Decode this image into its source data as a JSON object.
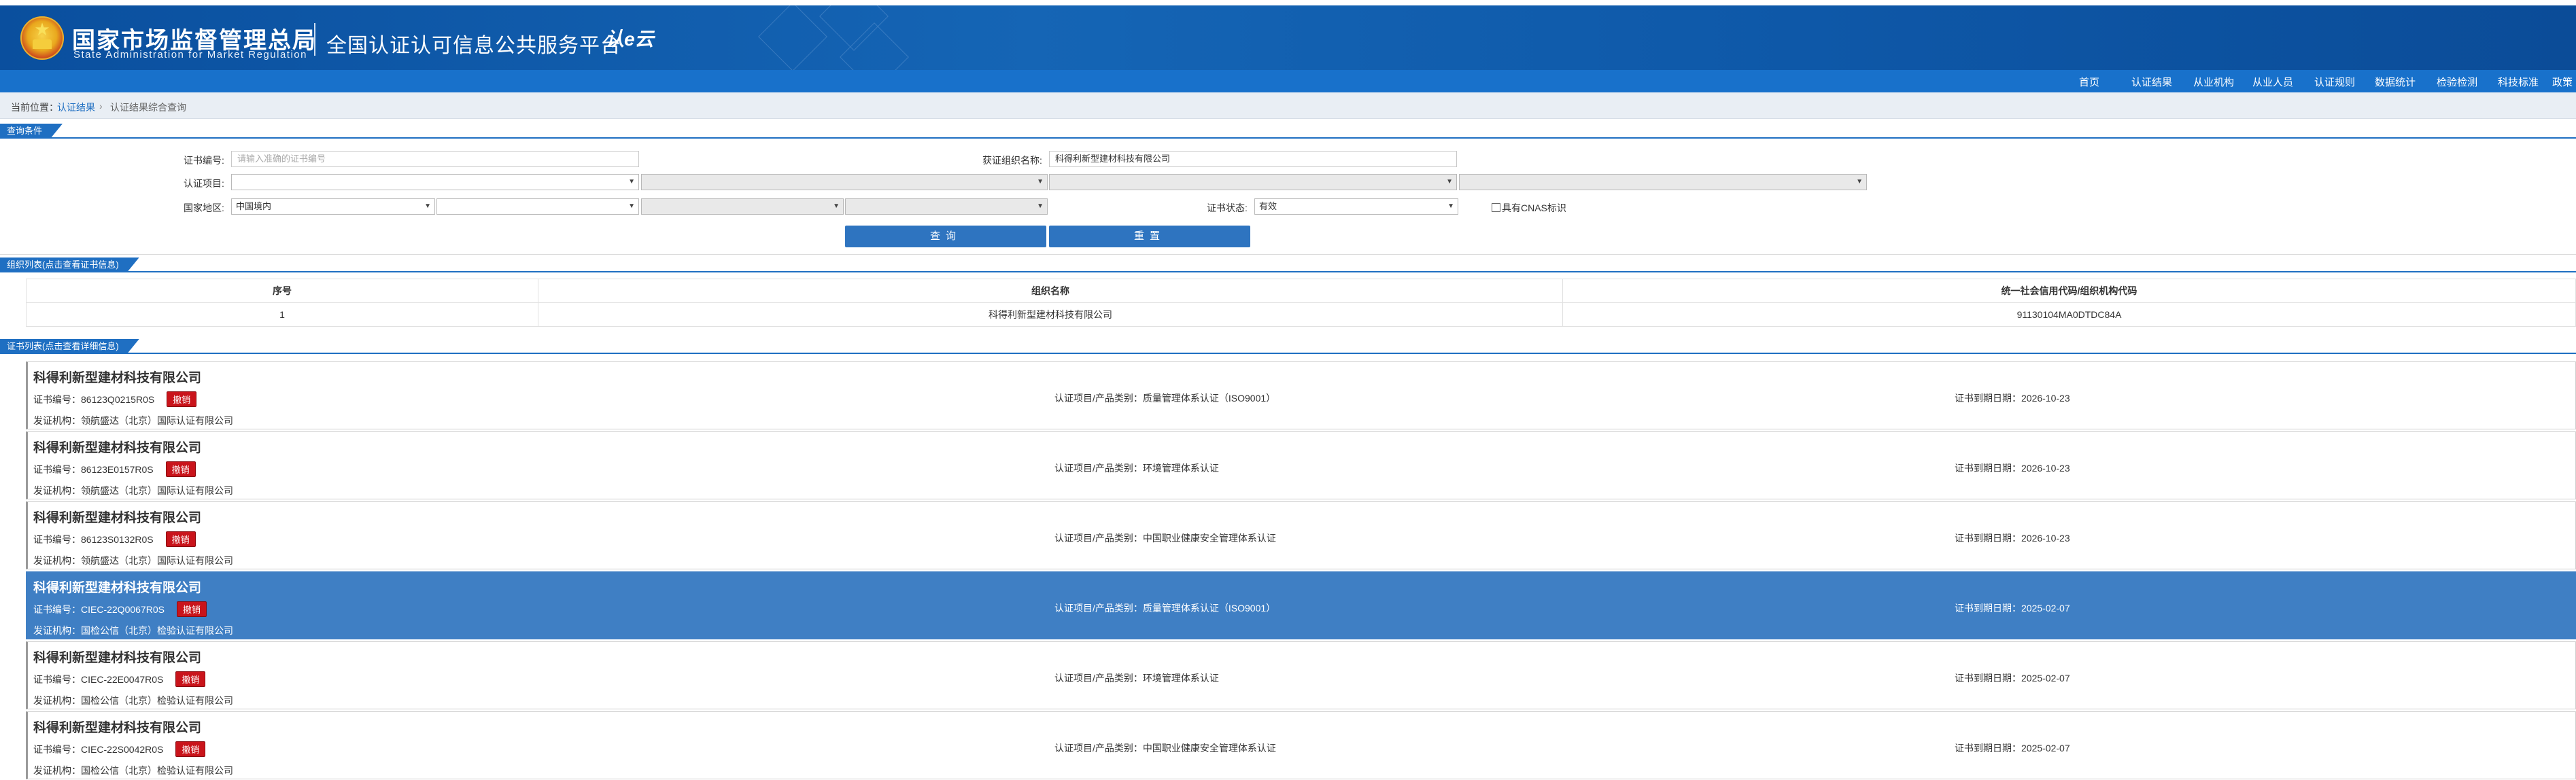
{
  "header": {
    "brand_cn": "国家市场监督管理总局",
    "brand_en": "State Administration for Market Regulation",
    "platform": "全国认证认可信息公共服务平台",
    "logo": "认e云"
  },
  "nav": [
    "首页",
    "认证结果",
    "从业机构",
    "从业人员",
    "认证规则",
    "数据统计",
    "检验检测",
    "科技标准",
    "政策"
  ],
  "breadcrumb": {
    "prefix": "当前位置：",
    "link": "认证结果",
    "sep": "›",
    "current": "认证结果综合查询"
  },
  "query": {
    "section": "查询条件",
    "cert_no_label": "证书编号:",
    "cert_no_placeholder": "请输入准确的证书编号",
    "org_label": "获证组织名称:",
    "org_value": "科得利新型建材科技有限公司",
    "project_label": "认证项目:",
    "region_label": "国家地区:",
    "region_value": "中国境内",
    "status_label": "证书状态:",
    "status_value": "有效",
    "cnas_label": "具有CNAS标识",
    "search_btn": "查询",
    "reset_btn": "重置"
  },
  "orglist": {
    "section": "组织列表(点击查看证书信息)",
    "headers": [
      "序号",
      "组织名称",
      "统一社会信用代码/组织机构代码"
    ],
    "rows": [
      {
        "idx": "1",
        "name": "科得利新型建材科技有限公司",
        "code": "91130104MA0DTDC84A"
      }
    ]
  },
  "certlist": {
    "section": "证书列表(点击查看详细信息)",
    "no_prefix": "证书编号：",
    "issuer_prefix": "发证机构：",
    "project_prefix": "认证项目/产品类别：",
    "expiry_prefix": "证书到期日期：",
    "items": [
      {
        "org": "科得利新型建材科技有限公司",
        "no": "86123Q0215R0S",
        "badge": "撤销",
        "issuer": "领航盛达（北京）国际认证有限公司",
        "project": "质量管理体系认证（ISO9001）",
        "expiry": "2026-10-23"
      },
      {
        "org": "科得利新型建材科技有限公司",
        "no": "86123E0157R0S",
        "badge": "撤销",
        "issuer": "领航盛达（北京）国际认证有限公司",
        "project": "环境管理体系认证",
        "expiry": "2026-10-23"
      },
      {
        "org": "科得利新型建材科技有限公司",
        "no": "86123S0132R0S",
        "badge": "撤销",
        "issuer": "领航盛达（北京）国际认证有限公司",
        "project": "中国职业健康安全管理体系认证",
        "expiry": "2026-10-23"
      },
      {
        "org": "科得利新型建材科技有限公司",
        "no": "CIEC-22Q0067R0S",
        "badge": "撤销",
        "issuer": "国检公信（北京）检验认证有限公司",
        "project": "质量管理体系认证（ISO9001）",
        "expiry": "2025-02-07"
      },
      {
        "org": "科得利新型建材科技有限公司",
        "no": "CIEC-22E0047R0S",
        "badge": "撤销",
        "issuer": "国检公信（北京）检验认证有限公司",
        "project": "环境管理体系认证",
        "expiry": "2025-02-07"
      },
      {
        "org": "科得利新型建材科技有限公司",
        "no": "CIEC-22S0042R0S",
        "badge": "撤销",
        "issuer": "国检公信（北京）检验认证有限公司",
        "project": "中国职业健康安全管理体系认证",
        "expiry": "2025-02-07"
      }
    ]
  },
  "colors": {
    "header": "#0e58a8",
    "nav": "#1871cb",
    "accent": "#1f6fc2",
    "selected": "#3f7fc4",
    "badge": "#c9141b"
  }
}
